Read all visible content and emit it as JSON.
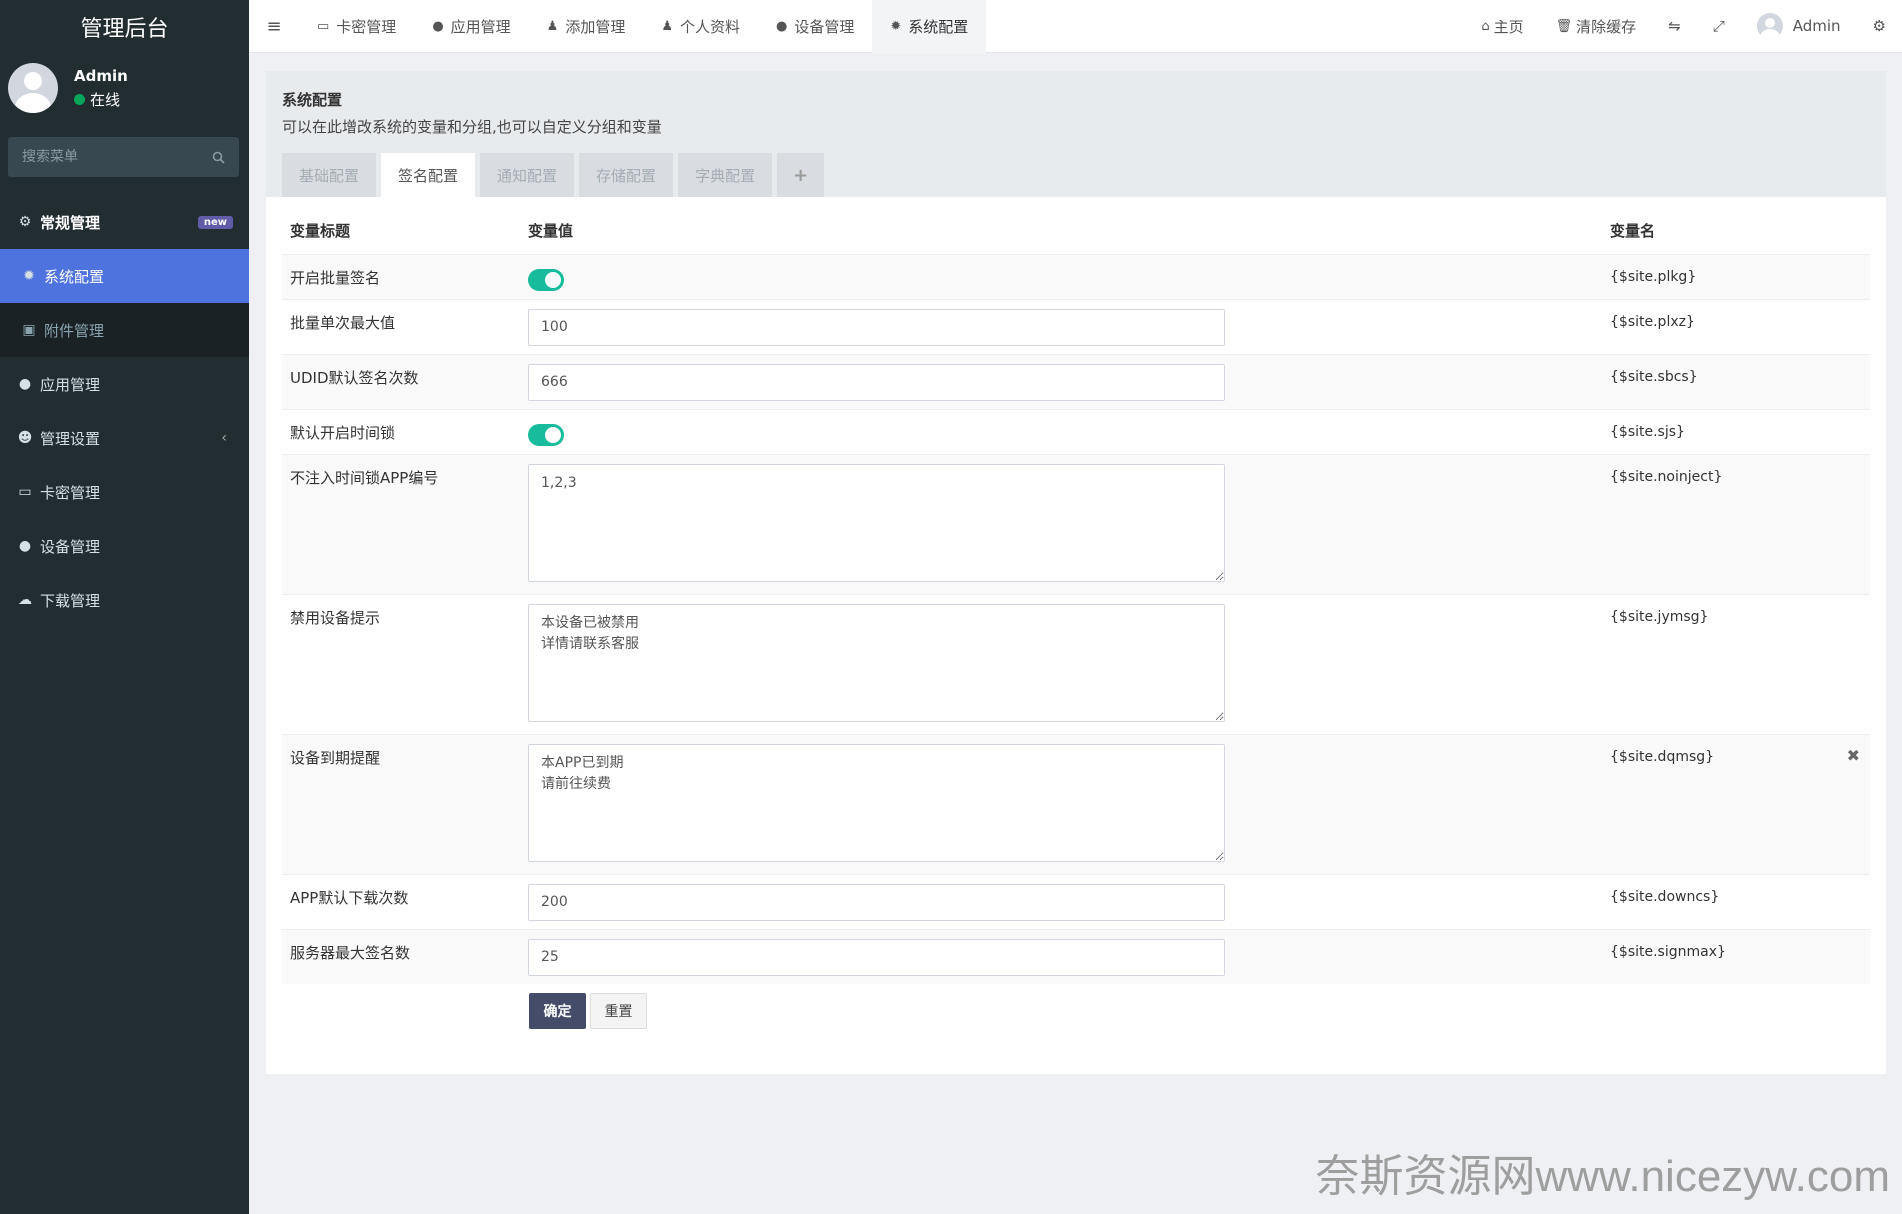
{
  "sidebar": {
    "brand": "管理后台",
    "user": {
      "name": "Admin",
      "status": "在线"
    },
    "search_placeholder": "搜索菜单",
    "items": [
      {
        "label": "常规管理",
        "icon": "cogs-icon",
        "badge": "new"
      },
      {
        "label": "系统配置",
        "icon": "gear-icon"
      },
      {
        "label": "附件管理",
        "icon": "image-icon"
      },
      {
        "label": "应用管理",
        "icon": "app-store-icon"
      },
      {
        "label": "管理设置",
        "icon": "users-icon"
      },
      {
        "label": "卡密管理",
        "icon": "credit-card-icon"
      },
      {
        "label": "设备管理",
        "icon": "apple-icon"
      },
      {
        "label": "下载管理",
        "icon": "cloud-download-icon"
      }
    ]
  },
  "topbar": {
    "tabs": [
      {
        "label": "卡密管理",
        "icon": "credit-card-icon"
      },
      {
        "label": "应用管理",
        "icon": "app-store-icon"
      },
      {
        "label": "添加管理",
        "icon": "user-icon"
      },
      {
        "label": "个人资料",
        "icon": "user-icon"
      },
      {
        "label": "设备管理",
        "icon": "apple-icon"
      },
      {
        "label": "系统配置",
        "icon": "gear-icon"
      }
    ],
    "home_label": "主页",
    "clear_cache_label": "清除缓存",
    "user_name": "Admin"
  },
  "panel": {
    "title": "系统配置",
    "subtitle": "可以在此增改系统的变量和分组,也可以自定义分组和变量",
    "tabs": [
      "基础配置",
      "签名配置",
      "通知配置",
      "存储配置",
      "字典配置"
    ],
    "active_tab": "签名配置",
    "columns": [
      "变量标题",
      "变量值",
      "变量名"
    ],
    "rows": [
      {
        "title": "开启批量签名",
        "type": "switch",
        "value": "on",
        "name": "{$site.plkg}"
      },
      {
        "title": "批量单次最大值",
        "type": "text",
        "value": "100",
        "name": "{$site.plxz}"
      },
      {
        "title": "UDID默认签名次数",
        "type": "text",
        "value": "666",
        "name": "{$site.sbcs}"
      },
      {
        "title": "默认开启时间锁",
        "type": "switch",
        "value": "on",
        "name": "{$site.sjs}"
      },
      {
        "title": "不注入时间锁APP编号",
        "type": "textarea",
        "value": "1,2,3",
        "name": "{$site.noinject}"
      },
      {
        "title": "禁用设备提示",
        "type": "textarea",
        "value": "本设备已被禁用\n详情请联系客服",
        "name": "{$site.jymsg}"
      },
      {
        "title": "设备到期提醒",
        "type": "textarea",
        "value": "本APP已到期\n请前往续费",
        "name": "{$site.dqmsg}"
      },
      {
        "title": "APP默认下载次数",
        "type": "text",
        "value": "200",
        "name": "{$site.downcs}"
      },
      {
        "title": "服务器最大签名数",
        "type": "text",
        "value": "25",
        "name": "{$site.signmax}"
      }
    ],
    "submit_label": "确定",
    "reset_label": "重置"
  },
  "watermark": "奈斯资源网www.nicezyw.com"
}
